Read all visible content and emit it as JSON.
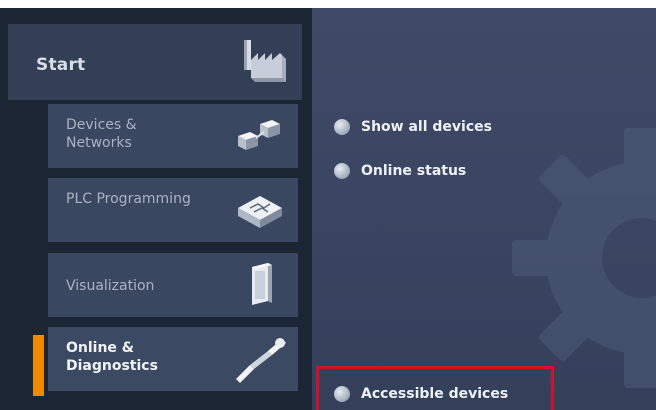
{
  "portal": {
    "start_label": "Start",
    "nav": [
      {
        "label": "Devices & Networks",
        "icon": "devices-networks-icon",
        "active": false
      },
      {
        "label": "PLC Programming",
        "icon": "plc-programming-icon",
        "active": false
      },
      {
        "label": "Visualization",
        "icon": "visualization-icon",
        "active": false
      },
      {
        "label": "Online & Diagnostics",
        "icon": "online-diagnostics-icon",
        "active": true
      }
    ]
  },
  "actions": [
    {
      "label": "Show all devices"
    },
    {
      "label": "Online status"
    },
    {
      "label": "Accessible devices",
      "highlighted": true
    }
  ],
  "colors": {
    "accent": "#f08a00",
    "highlight": "#d0112b",
    "panel_dark": "#1c2534",
    "panel_right": "#3a4661"
  }
}
